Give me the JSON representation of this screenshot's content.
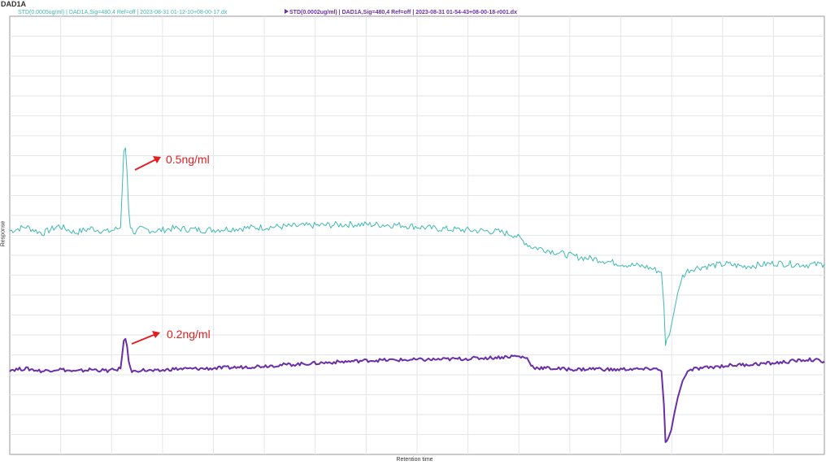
{
  "chart_data": {
    "type": "line",
    "title": "DAD1A",
    "xlabel": "Retention time",
    "ylabel": "Response",
    "grid": true,
    "legend_position": "top",
    "series": [
      {
        "name": "STD(0.0005ug/ml) | DAD1A,Sig=480,4 Ref=off | 2023-08-31 01-12-10+08-00-17.dx",
        "color": "#3fb8b3",
        "x": [
          0,
          20,
          40,
          60,
          80,
          100,
          120,
          130,
          136,
          138,
          140,
          142,
          144,
          146,
          148,
          150,
          154,
          160,
          180,
          200,
          240,
          300,
          360,
          420,
          480,
          520,
          560,
          600,
          620,
          630,
          640,
          660,
          680,
          700,
          720,
          740,
          760,
          780,
          790,
          800,
          803,
          805,
          808,
          812,
          816,
          820,
          826,
          832,
          840,
          860,
          880,
          900,
          940,
          980,
          1000
        ],
        "y": [
          0.0,
          0.5,
          -0.3,
          0.6,
          -0.2,
          0.3,
          -0.1,
          0.2,
          0.4,
          5.0,
          9.8,
          10.0,
          7.0,
          2.5,
          0.6,
          0.1,
          -0.2,
          0.2,
          0.0,
          0.3,
          0.1,
          0.4,
          0.6,
          0.8,
          0.7,
          0.3,
          0.1,
          -0.1,
          -0.5,
          -1.2,
          -1.9,
          -2.3,
          -2.8,
          -3.2,
          -3.4,
          -3.8,
          -4.1,
          -4.3,
          -4.6,
          -5.0,
          -9.0,
          -13.6,
          -13.0,
          -11.5,
          -9.5,
          -7.5,
          -5.5,
          -4.8,
          -4.5,
          -4.2,
          -4.0,
          -4.3,
          -3.9,
          -4.1,
          -4.0
        ]
      },
      {
        "name": "STD(0.0002ug/ml) | DAD1A,Sig=480,4 Ref=off | 2023-08-31 01-54-43+08-00-18-r001.dx",
        "color": "#6a2fa8",
        "x": [
          0,
          20,
          40,
          60,
          80,
          100,
          120,
          130,
          136,
          138,
          140,
          142,
          144,
          146,
          148,
          150,
          154,
          160,
          180,
          200,
          240,
          280,
          320,
          360,
          400,
          440,
          480,
          520,
          560,
          600,
          620,
          635,
          640,
          645,
          660,
          680,
          700,
          720,
          740,
          760,
          780,
          790,
          800,
          803,
          805,
          808,
          812,
          816,
          820,
          826,
          832,
          840,
          860,
          880,
          900,
          940,
          980,
          1000
        ],
        "y": [
          0.0,
          0.3,
          -0.3,
          0.2,
          -0.4,
          0.1,
          -0.2,
          0.0,
          0.3,
          3.5,
          7.0,
          7.2,
          5.5,
          2.0,
          0.2,
          -0.2,
          -0.4,
          0.0,
          -0.3,
          0.2,
          0.3,
          0.6,
          1.0,
          1.4,
          1.8,
          2.2,
          2.3,
          2.4,
          2.6,
          2.9,
          3.2,
          2.8,
          1.0,
          0.5,
          0.4,
          0.2,
          0.1,
          0.3,
          0.0,
          0.2,
          0.1,
          0.4,
          -0.3,
          -8.0,
          -16.5,
          -16.0,
          -14.0,
          -10.0,
          -6.5,
          -2.5,
          -0.5,
          0.2,
          0.6,
          1.0,
          1.2,
          1.6,
          2.4,
          2.0
        ]
      }
    ],
    "annotations": [
      {
        "text": "0.5ng/ml",
        "color": "#e02020"
      },
      {
        "text": "0.2ng/ml",
        "color": "#e02020"
      }
    ]
  }
}
